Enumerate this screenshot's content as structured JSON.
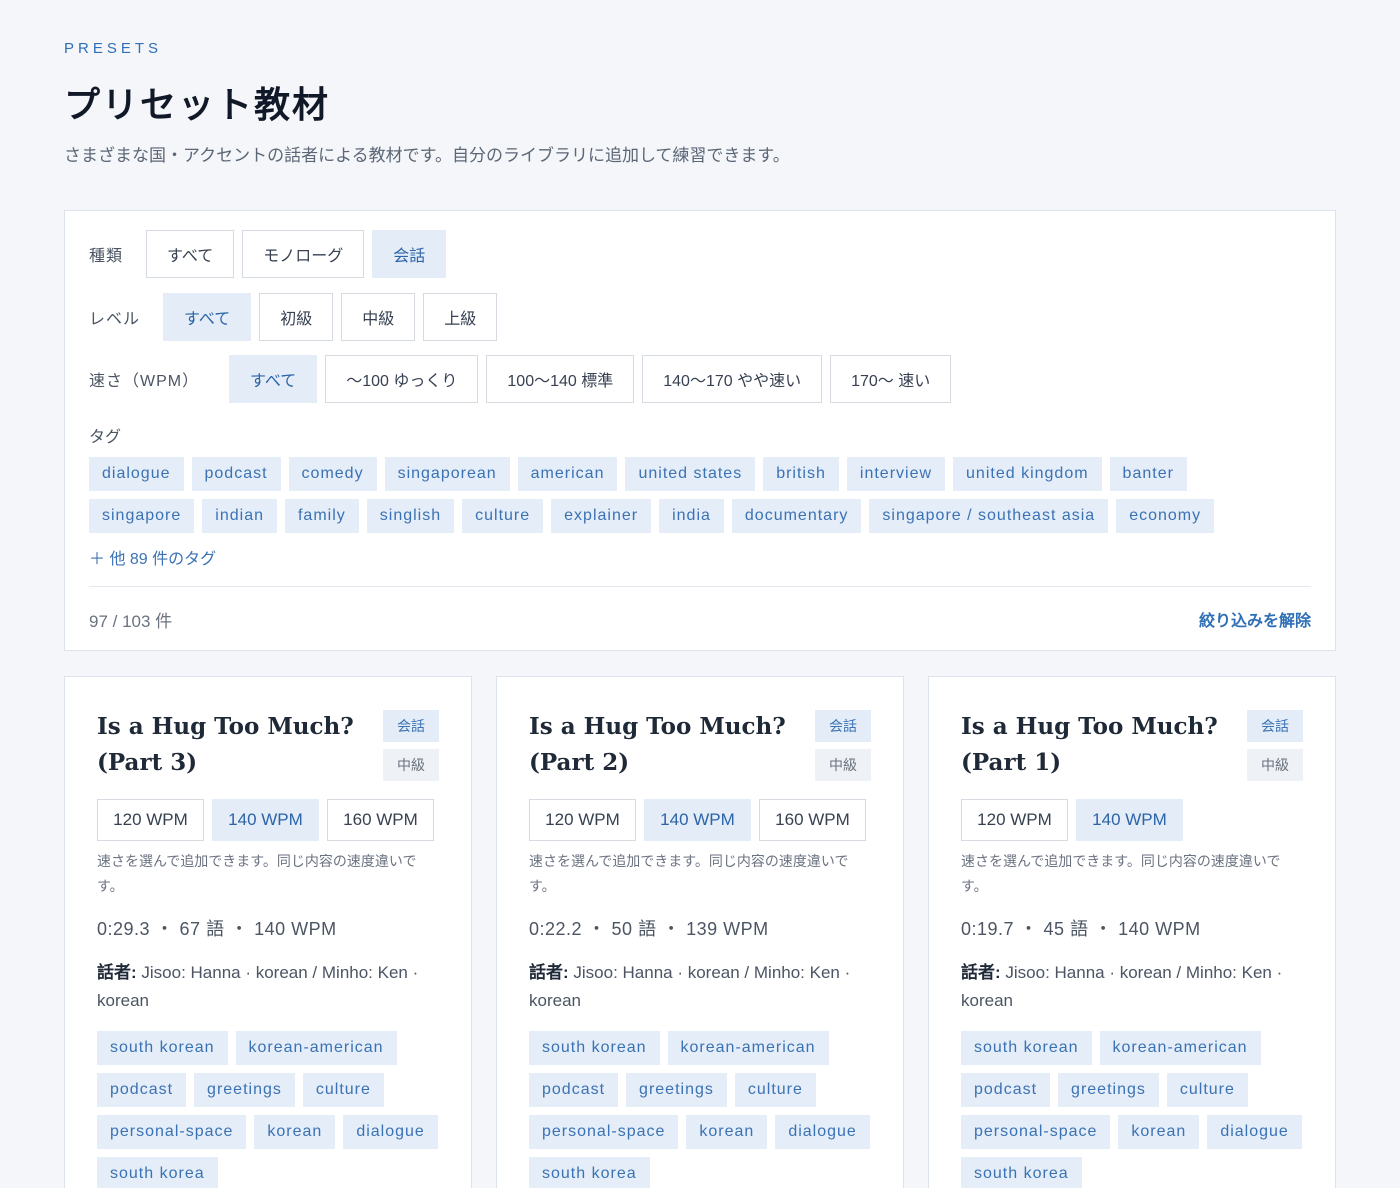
{
  "header": {
    "eyebrow": "PRESETS",
    "title": "プリセット教材",
    "subtitle": "さまざまな国・アクセントの話者による教材です。自分のライブラリに追加して練習できます。"
  },
  "filters": {
    "type": {
      "label": "種類",
      "options": [
        "すべて",
        "モノローグ",
        "会話"
      ],
      "selected": "会話"
    },
    "level": {
      "label": "レベル",
      "options": [
        "すべて",
        "初級",
        "中級",
        "上級"
      ],
      "selected": "すべて"
    },
    "speed": {
      "label": "速さ（WPM）",
      "options": [
        "すべて",
        "〜100 ゆっくり",
        "100〜140 標準",
        "140〜170 やや速い",
        "170〜 速い"
      ],
      "selected": "すべて"
    },
    "tags": {
      "label": "タグ",
      "row1": [
        "dialogue",
        "podcast",
        "comedy",
        "singaporean",
        "american",
        "united states",
        "british",
        "interview",
        "united kingdom",
        "banter"
      ],
      "row2": [
        "singapore",
        "indian",
        "family",
        "singlish",
        "culture",
        "explainer",
        "india",
        "documentary",
        "singapore / southeast asia",
        "economy"
      ],
      "more": "＋ 他 89 件のタグ"
    },
    "count": "97 / 103 件",
    "clear": "絞り込みを解除"
  },
  "cards": [
    {
      "title": "Is a Hug Too Much? (Part 3)",
      "type_badge": "会話",
      "level_badge": "中級",
      "speeds": [
        "120 WPM",
        "140 WPM",
        "160 WPM"
      ],
      "active_speed": "140 WPM",
      "hint": "速さを選んで追加できます。同じ内容の速度違いです。",
      "stats": "0:29.3 ・ 67 語 ・ 140 WPM",
      "speakers_label": "話者:",
      "speakers": " Jisoo: Hanna · korean / Minho: Ken · korean",
      "tags": [
        "south korean",
        "korean-american",
        "podcast",
        "greetings",
        "culture",
        "personal-space",
        "korean",
        "dialogue",
        "south korea"
      ]
    },
    {
      "title": "Is a Hug Too Much? (Part 2)",
      "type_badge": "会話",
      "level_badge": "中級",
      "speeds": [
        "120 WPM",
        "140 WPM",
        "160 WPM"
      ],
      "active_speed": "140 WPM",
      "hint": "速さを選んで追加できます。同じ内容の速度違いです。",
      "stats": "0:22.2 ・ 50 語 ・ 139 WPM",
      "speakers_label": "話者:",
      "speakers": " Jisoo: Hanna · korean / Minho: Ken · korean",
      "tags": [
        "south korean",
        "korean-american",
        "podcast",
        "greetings",
        "culture",
        "personal-space",
        "korean",
        "dialogue",
        "south korea"
      ]
    },
    {
      "title": "Is a Hug Too Much? (Part 1)",
      "type_badge": "会話",
      "level_badge": "中級",
      "speeds": [
        "120 WPM",
        "140 WPM"
      ],
      "active_speed": "140 WPM",
      "hint": "速さを選んで追加できます。同じ内容の速度違いです。",
      "stats": "0:19.7 ・ 45 語 ・ 140 WPM",
      "speakers_label": "話者:",
      "speakers": " Jisoo: Hanna · korean / Minho: Ken · korean",
      "tags": [
        "south korean",
        "korean-american",
        "podcast",
        "greetings",
        "culture",
        "personal-space",
        "korean",
        "dialogue",
        "south korea"
      ]
    }
  ]
}
